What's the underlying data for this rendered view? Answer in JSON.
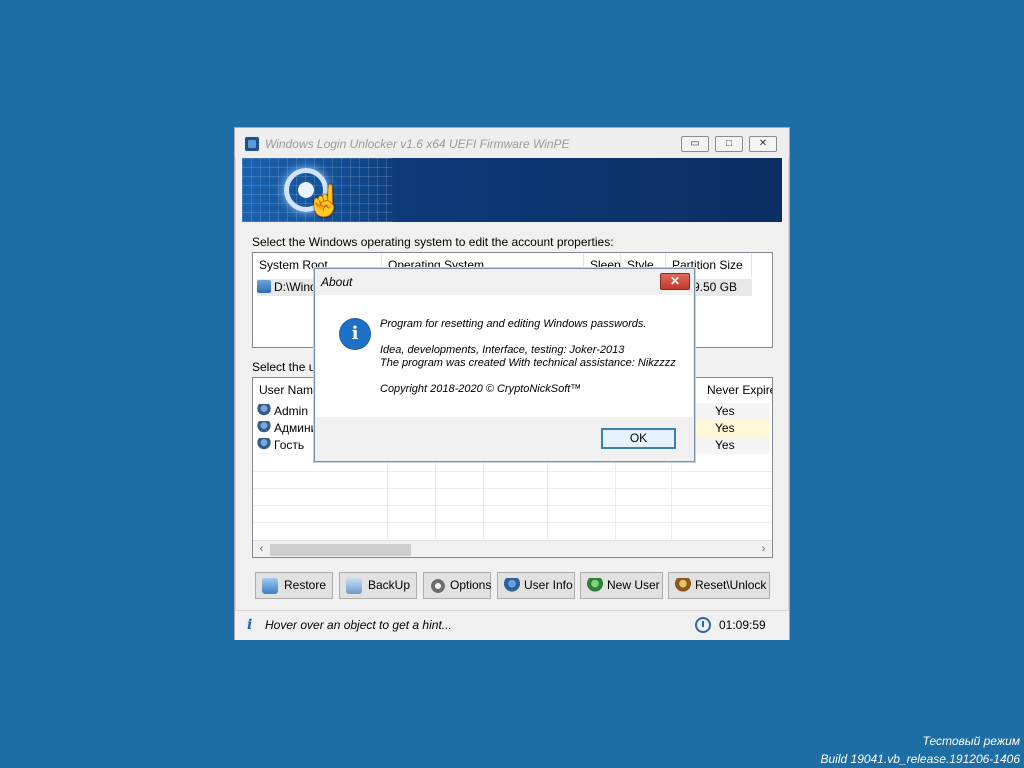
{
  "window": {
    "title": "Windows Login Unlocker v1.6 x64  UEFI Firmware WinPE",
    "minimize_glyph": "▭",
    "maximize_glyph": "□",
    "close_glyph": "✕"
  },
  "os_section": {
    "label": "Select the Windows operating system to edit the account properties:",
    "columns": [
      "System Root",
      "Operating System",
      "Sleep",
      "Style",
      "Partition Size"
    ],
    "rows": [
      {
        "system_root": "D:\\Windows",
        "operating_system": "",
        "sleep": "",
        "style": "",
        "partition_size": "9.50 GB"
      }
    ]
  },
  "user_section": {
    "label": "Select the user",
    "columns": [
      "User Name",
      "",
      "",
      "",
      "",
      "",
      "Never Expire"
    ],
    "rows": [
      {
        "name": "Admin",
        "never_expire": "Yes",
        "highlight": false
      },
      {
        "name": "Админи",
        "never_expire": "Yes",
        "highlight": true
      },
      {
        "name": "Гость",
        "never_expire": "Yes",
        "highlight": false
      }
    ]
  },
  "buttons": {
    "restore": "Restore",
    "backup": "BackUp",
    "options": "Options",
    "user_info": "User Info",
    "new_user": "New User",
    "reset_unlock": "Reset\\Unlock"
  },
  "status": {
    "hint": "Hover over an object to get a hint...",
    "time": "01:09:59"
  },
  "about_dialog": {
    "title": "About",
    "close_glyph": "✕",
    "line1": "Program for resetting and editing Windows passwords.",
    "line2": "Idea, developments, Interface, testing: Joker-2013",
    "line3": "The program was created With technical assistance: Nikzzzz",
    "line4": "Copyright 2018-2020 © CryptoNickSoft™",
    "ok_label": "OK"
  },
  "desktop": {
    "watermark_line1": "Тестовый режим",
    "watermark_line2": "Build 19041.vb_release.191206-1406"
  },
  "colors": {
    "desktop": "#1c6ea4",
    "banner": "#0b2f63",
    "highlight_row": "#fff8d9",
    "accent": "#1e6fc6"
  },
  "icons": [
    "app-icon",
    "banner-logo-icon",
    "drive-icon",
    "user-icon",
    "restore-icon",
    "backup-icon",
    "options-icon",
    "user-info-icon",
    "new-user-icon",
    "reset-unlock-icon",
    "info-icon",
    "clock-icon"
  ]
}
